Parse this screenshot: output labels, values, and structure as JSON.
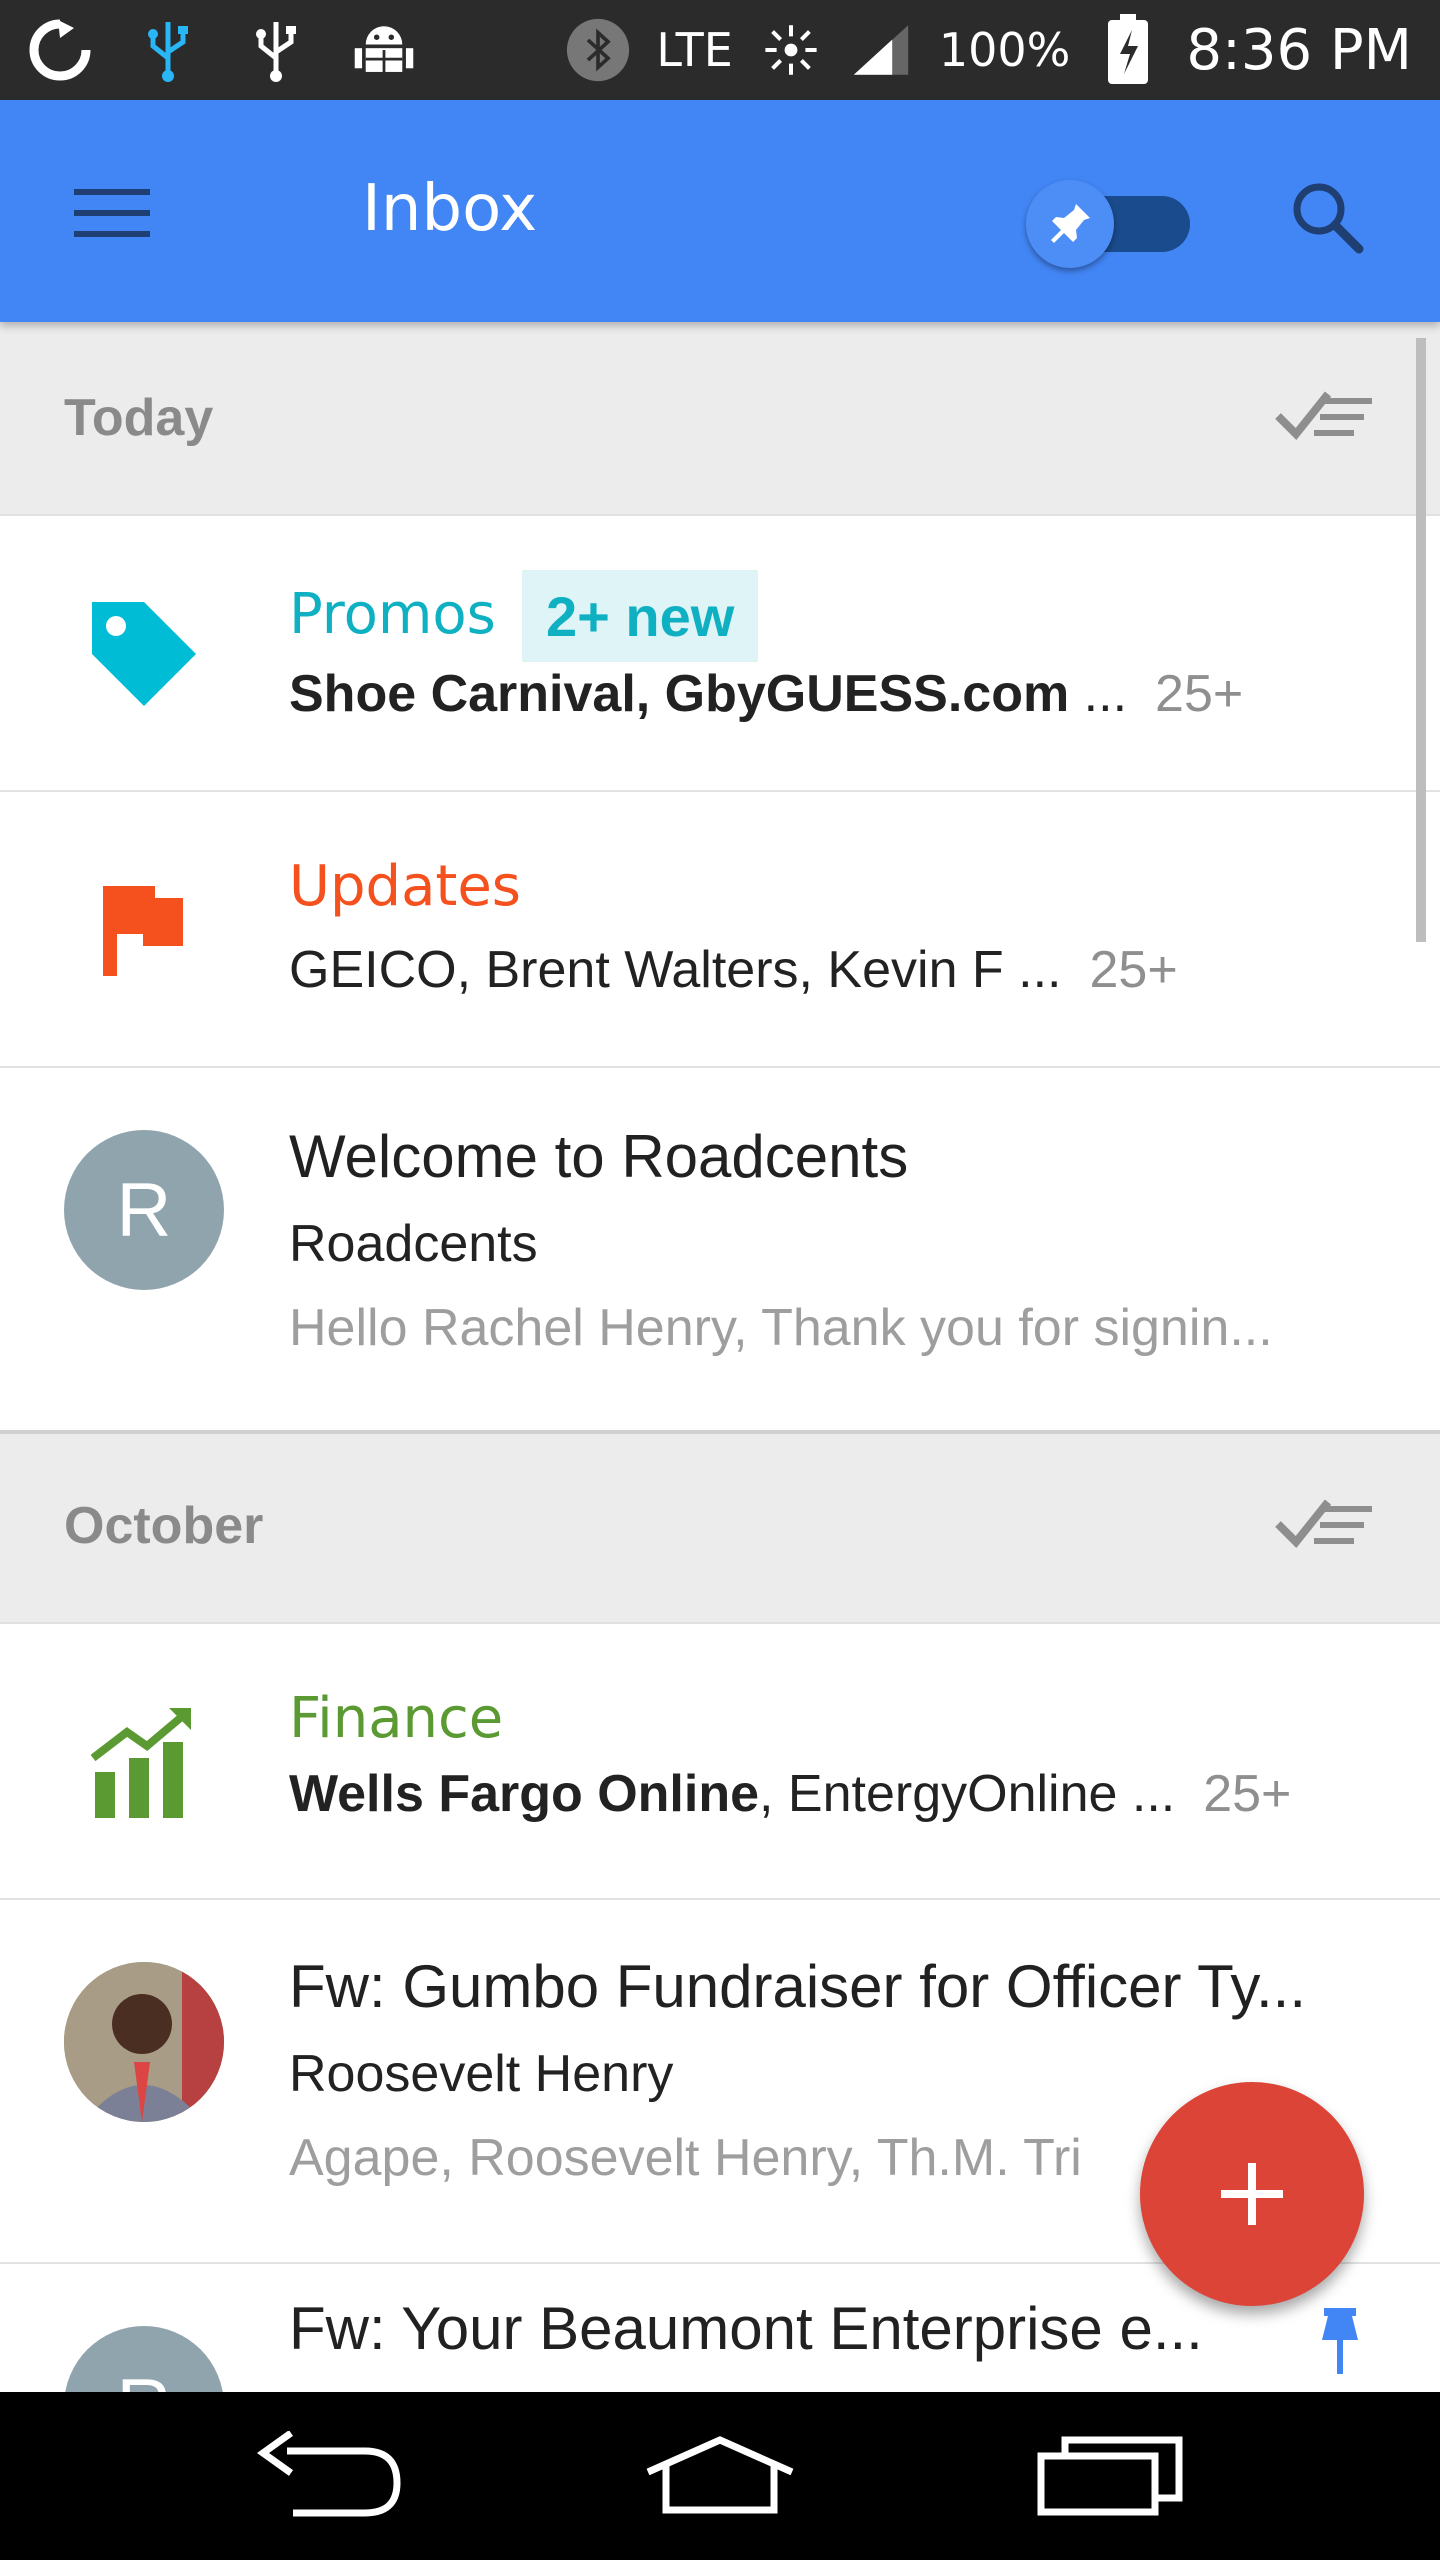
{
  "status_bar": {
    "network": "LTE",
    "battery": "100%",
    "time": "8:36 PM",
    "icons": [
      "sync-icon",
      "usb-icon",
      "usb-icon",
      "android-debug-icon",
      "bluetooth-icon",
      "brightness-icon",
      "signal-icon",
      "battery-charging-icon"
    ]
  },
  "toolbar": {
    "title": "Inbox",
    "menu_icon": "hamburger-menu-icon",
    "pin_toggle_icon": "pin-icon",
    "search_icon": "search-icon",
    "color": "#4285f4"
  },
  "sections": [
    {
      "label": "Today",
      "items": [
        {
          "type": "bundle",
          "category": "Promos",
          "category_color": "#10b0c3",
          "badge": "2+ new",
          "senders_bold": "Shoe Carnival, GbyGUESS.com",
          "senders_rest": " ...",
          "count": "25+",
          "icon": "tag-icon"
        },
        {
          "type": "bundle",
          "category": "Updates",
          "category_color": "#f4511e",
          "senders_bold": "",
          "senders_rest": "GEICO, Brent Walters, Kevin F ...",
          "count": "25+",
          "icon": "flag-icon"
        },
        {
          "type": "message",
          "avatar_letter": "R",
          "subject": "Welcome to Roadcents",
          "from": "Roadcents",
          "snippet": "Hello Rachel Henry, Thank you for signin..."
        }
      ]
    },
    {
      "label": "October",
      "items": [
        {
          "type": "bundle",
          "category": "Finance",
          "category_color": "#5b9a32",
          "senders_bold": "Wells Fargo Online",
          "senders_rest": ", EntergyOnline ...",
          "count": "25+",
          "icon": "finance-chart-icon"
        },
        {
          "type": "message",
          "avatar_letter": "",
          "subject": "Fw: Gumbo Fundraiser for Officer Ty...",
          "from": "Roosevelt Henry",
          "snippet": "Agape, Roosevelt Henry, Th.M. Tri"
        },
        {
          "type": "message",
          "avatar_letter": "R",
          "subject": "Fw: Your Beaumont Enterprise e...",
          "pinned": true
        }
      ]
    }
  ],
  "fab": {
    "icon": "plus-icon",
    "color": "#db4437"
  },
  "nav_bar": {
    "icons": [
      "back-icon",
      "home-icon",
      "recents-icon"
    ]
  }
}
